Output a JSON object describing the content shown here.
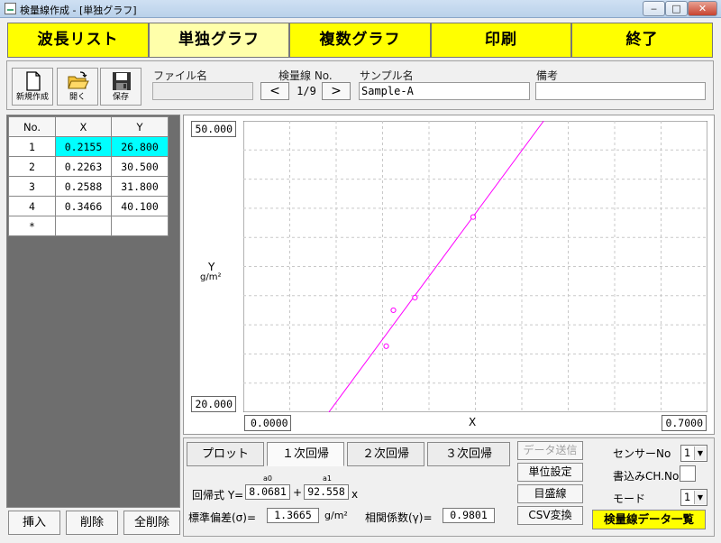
{
  "window": {
    "title": "検量線作成 - [単独グラフ]",
    "min": "‒",
    "max": "□",
    "close": "✕"
  },
  "tabs": [
    {
      "label": "波長リスト"
    },
    {
      "label": "単独グラフ"
    },
    {
      "label": "複数グラフ"
    },
    {
      "label": "印刷"
    },
    {
      "label": "終了"
    }
  ],
  "toolbar": {
    "new_label": "新規作成",
    "open_label": "開く",
    "save_label": "保存",
    "file_label": "ファイル名",
    "file_value": "",
    "curve_no_label": "検量線 No.",
    "prev": "<",
    "next": ">",
    "page": "1/9",
    "sample_label": "サンプル名",
    "sample_value": "Sample-A",
    "notes_label": "備考",
    "notes_value": ""
  },
  "grid": {
    "headers": [
      "No.",
      "X",
      "Y"
    ],
    "rows": [
      {
        "no": "1",
        "x": "0.2155",
        "y": "26.800"
      },
      {
        "no": "2",
        "x": "0.2263",
        "y": "30.500"
      },
      {
        "no": "3",
        "x": "0.2588",
        "y": "31.800"
      },
      {
        "no": "4",
        "x": "0.3466",
        "y": "40.100"
      },
      {
        "no": "*",
        "x": "",
        "y": ""
      }
    ]
  },
  "left_buttons": {
    "insert": "挿入",
    "delete": "削除",
    "delete_all": "全削除"
  },
  "chart_data": {
    "type": "scatter",
    "points": [
      {
        "x": 0.2155,
        "y": 26.8
      },
      {
        "x": 0.2263,
        "y": 30.5
      },
      {
        "x": 0.2588,
        "y": 31.8
      },
      {
        "x": 0.3466,
        "y": 40.1
      }
    ],
    "fit_line": {
      "intercept": 8.0681,
      "slope": 92.558
    },
    "xlim": [
      0.0,
      0.7
    ],
    "ylim": [
      20.0,
      50.0
    ],
    "x_min_label": "0.0000",
    "x_max_label": "0.7000",
    "y_min_label": "20.000",
    "y_max_label": "50.000",
    "xlabel": "X",
    "ylabel": "Y",
    "yunit": "g/m²",
    "grid": true,
    "color": "#ff00ff"
  },
  "regression": {
    "tabs": [
      "プロット",
      "１次回帰",
      "２次回帰",
      "３次回帰"
    ],
    "formula_label": "回帰式 Y=",
    "a0_label": "a0",
    "a0_value": "8.0681",
    "plus": "+",
    "a1_label": "a1",
    "a1_value": "92.558",
    "x_suffix": "x",
    "stddev_label": "標準偏差(σ)=",
    "stddev_value": "1.3665",
    "stddev_unit": "g/m²",
    "corr_label": "相関係数(γ)=",
    "corr_value": "0.9801"
  },
  "side_buttons": {
    "send": "データ送信",
    "unit": "単位設定",
    "scale": "目盛線",
    "csv": "CSV変換"
  },
  "settings": {
    "sensor_label": "センサーNo",
    "sensor_value": "1",
    "write_ch_label": "書込みCH.No",
    "write_ch_value": "",
    "mode_label": "モード",
    "mode_value": "1",
    "list_button": "検量線データ一覧"
  }
}
